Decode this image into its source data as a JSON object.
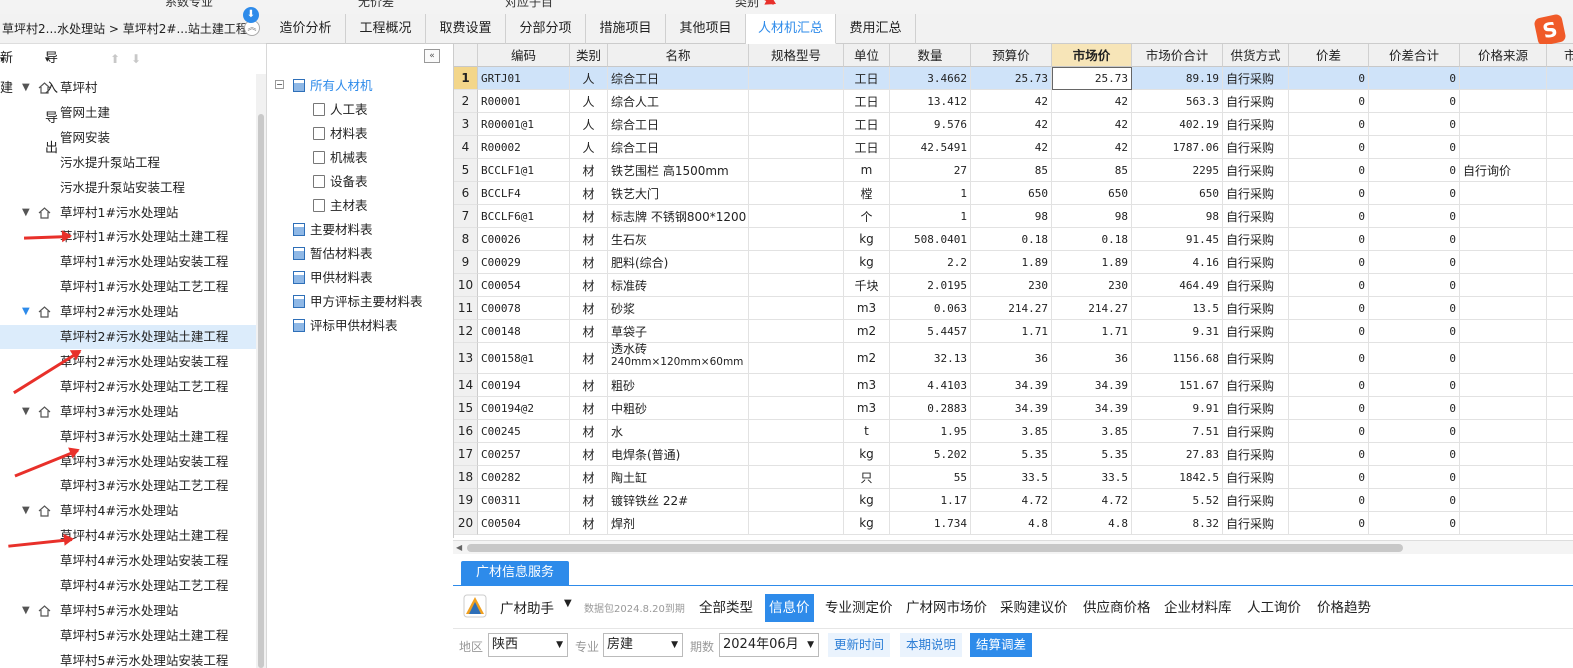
{
  "top_strip": {
    "items": [
      "系数专业",
      "无价差",
      "对应子目",
      "类别"
    ]
  },
  "breadcrumb": {
    "text": "草坪村2...水处理站 > 草坪村2#...站土建工程"
  },
  "tabs": [
    {
      "label": "造价分析"
    },
    {
      "label": "工程概况"
    },
    {
      "label": "取费设置"
    },
    {
      "label": "分部分项"
    },
    {
      "label": "措施项目"
    },
    {
      "label": "其他项目"
    },
    {
      "label": "人材机汇总"
    },
    {
      "label": "费用汇总"
    }
  ],
  "active_tab": "人材机汇总",
  "left_toolbar": {
    "new_label": "新建",
    "import_export_label": "导入导出"
  },
  "tree": {
    "items": [
      {
        "label": "草坪村",
        "level": 0
      },
      {
        "label": "管网土建",
        "level": 1
      },
      {
        "label": "管网安装",
        "level": 1
      },
      {
        "label": "污水提升泵站工程",
        "level": 1
      },
      {
        "label": "污水提升泵站安装工程",
        "level": 1
      },
      {
        "label": "草坪村1#污水处理站",
        "level": 0
      },
      {
        "label": "草坪村1#污水处理站土建工程",
        "level": 1
      },
      {
        "label": "草坪村1#污水处理站安装工程",
        "level": 1
      },
      {
        "label": "草坪村1#污水处理站工艺工程",
        "level": 1
      },
      {
        "label": "草坪村2#污水处理站",
        "level": 0
      },
      {
        "label": "草坪村2#污水处理站土建工程",
        "level": 1,
        "selected": true
      },
      {
        "label": "草坪村2#污水处理站安装工程",
        "level": 1
      },
      {
        "label": "草坪村2#污水处理站工艺工程",
        "level": 1
      },
      {
        "label": "草坪村3#污水处理站",
        "level": 0
      },
      {
        "label": "草坪村3#污水处理站土建工程",
        "level": 1
      },
      {
        "label": "草坪村3#污水处理站安装工程",
        "level": 1
      },
      {
        "label": "草坪村3#污水处理站工艺工程",
        "level": 1
      },
      {
        "label": "草坪村4#污水处理站",
        "level": 0
      },
      {
        "label": "草坪村4#污水处理站土建工程",
        "level": 1
      },
      {
        "label": "草坪村4#污水处理站安装工程",
        "level": 1
      },
      {
        "label": "草坪村4#污水处理站工艺工程",
        "level": 1
      },
      {
        "label": "草坪村5#污水处理站",
        "level": 0
      },
      {
        "label": "草坪村5#污水处理站土建工程",
        "level": 1
      },
      {
        "label": "草坪村5#污水处理站安装工程",
        "level": 1
      }
    ]
  },
  "categories": {
    "root": "所有人材机",
    "children": [
      "人工表",
      "材料表",
      "机械表",
      "设备表",
      "主材表"
    ],
    "tables": [
      "主要材料表",
      "暂估材料表",
      "甲供材料表",
      "甲方评标主要材料表",
      "评标甲供材料表"
    ]
  },
  "grid": {
    "columns": [
      "",
      "编码",
      "类别",
      "名称",
      "规格型号",
      "单位",
      "数量",
      "预算价",
      "市场价",
      "市场价合计",
      "供货方式",
      "价差",
      "价差合计",
      "价格来源",
      "市场"
    ],
    "rows": [
      {
        "n": "1",
        "code": "GRTJ01",
        "type": "人",
        "name": "综合工日",
        "spec": "",
        "unit": "工日",
        "qty": "3.4662",
        "budget": "25.73",
        "market": "25.73",
        "total": "89.19",
        "supply": "自行采购",
        "diff": "0",
        "diff_total": "0",
        "source": ""
      },
      {
        "n": "2",
        "code": "R00001",
        "type": "人",
        "name": "综合人工",
        "spec": "",
        "unit": "工日",
        "qty": "13.412",
        "budget": "42",
        "market": "42",
        "total": "563.3",
        "supply": "自行采购",
        "diff": "0",
        "diff_total": "0",
        "source": ""
      },
      {
        "n": "3",
        "code": "R00001@1",
        "type": "人",
        "name": "综合工日",
        "spec": "",
        "unit": "工日",
        "qty": "9.576",
        "budget": "42",
        "market": "42",
        "total": "402.19",
        "supply": "自行采购",
        "diff": "0",
        "diff_total": "0",
        "source": ""
      },
      {
        "n": "4",
        "code": "R00002",
        "type": "人",
        "name": "综合工日",
        "spec": "",
        "unit": "工日",
        "qty": "42.5491",
        "budget": "42",
        "market": "42",
        "total": "1787.06",
        "supply": "自行采购",
        "diff": "0",
        "diff_total": "0",
        "source": ""
      },
      {
        "n": "5",
        "code": "BCCLF1@1",
        "type": "材",
        "name": "铁艺围栏 高1500mm",
        "spec": "",
        "unit": "m",
        "qty": "27",
        "budget": "85",
        "market": "85",
        "total": "2295",
        "supply": "自行采购",
        "diff": "0",
        "diff_total": "0",
        "source": "自行询价"
      },
      {
        "n": "6",
        "code": "BCCLF4",
        "type": "材",
        "name": "铁艺大门",
        "spec": "",
        "unit": "樘",
        "qty": "1",
        "budget": "650",
        "market": "650",
        "total": "650",
        "supply": "自行采购",
        "diff": "0",
        "diff_total": "0",
        "source": ""
      },
      {
        "n": "7",
        "code": "BCCLF6@1",
        "type": "材",
        "name": "标志牌 不锈钢800*1200",
        "spec": "",
        "unit": "个",
        "qty": "1",
        "budget": "98",
        "market": "98",
        "total": "98",
        "supply": "自行采购",
        "diff": "0",
        "diff_total": "0",
        "source": ""
      },
      {
        "n": "8",
        "code": "C00026",
        "type": "材",
        "name": "生石灰",
        "spec": "",
        "unit": "kg",
        "qty": "508.0401",
        "budget": "0.18",
        "market": "0.18",
        "total": "91.45",
        "supply": "自行采购",
        "diff": "0",
        "diff_total": "0",
        "source": ""
      },
      {
        "n": "9",
        "code": "C00029",
        "type": "材",
        "name": "肥料(综合)",
        "spec": "",
        "unit": "kg",
        "qty": "2.2",
        "budget": "1.89",
        "market": "1.89",
        "total": "4.16",
        "supply": "自行采购",
        "diff": "0",
        "diff_total": "0",
        "source": ""
      },
      {
        "n": "10",
        "code": "C00054",
        "type": "材",
        "name": "标准砖",
        "spec": "",
        "unit": "千块",
        "qty": "2.0195",
        "budget": "230",
        "market": "230",
        "total": "464.49",
        "supply": "自行采购",
        "diff": "0",
        "diff_total": "0",
        "source": ""
      },
      {
        "n": "11",
        "code": "C00078",
        "type": "材",
        "name": "砂浆",
        "spec": "",
        "unit": "m3",
        "qty": "0.063",
        "budget": "214.27",
        "market": "214.27",
        "total": "13.5",
        "supply": "自行采购",
        "diff": "0",
        "diff_total": "0",
        "source": ""
      },
      {
        "n": "12",
        "code": "C00148",
        "type": "材",
        "name": "草袋子",
        "spec": "",
        "unit": "m2",
        "qty": "5.4457",
        "budget": "1.71",
        "market": "1.71",
        "total": "9.31",
        "supply": "自行采购",
        "diff": "0",
        "diff_total": "0",
        "source": ""
      },
      {
        "n": "13",
        "code": "C00158@1",
        "type": "材",
        "name": "透水砖",
        "name2": "240mm×120mm×60mm",
        "spec": "",
        "unit": "m2",
        "qty": "32.13",
        "budget": "36",
        "market": "36",
        "total": "1156.68",
        "supply": "自行采购",
        "diff": "0",
        "diff_total": "0",
        "source": ""
      },
      {
        "n": "14",
        "code": "C00194",
        "type": "材",
        "name": "粗砂",
        "spec": "",
        "unit": "m3",
        "qty": "4.4103",
        "budget": "34.39",
        "market": "34.39",
        "total": "151.67",
        "supply": "自行采购",
        "diff": "0",
        "diff_total": "0",
        "source": ""
      },
      {
        "n": "15",
        "code": "C00194@2",
        "type": "材",
        "name": "中粗砂",
        "spec": "",
        "unit": "m3",
        "qty": "0.2883",
        "budget": "34.39",
        "market": "34.39",
        "total": "9.91",
        "supply": "自行采购",
        "diff": "0",
        "diff_total": "0",
        "source": ""
      },
      {
        "n": "16",
        "code": "C00245",
        "type": "材",
        "name": "水",
        "spec": "",
        "unit": "t",
        "qty": "1.95",
        "budget": "3.85",
        "market": "3.85",
        "total": "7.51",
        "supply": "自行采购",
        "diff": "0",
        "diff_total": "0",
        "source": ""
      },
      {
        "n": "17",
        "code": "C00257",
        "type": "材",
        "name": "电焊条(普通)",
        "spec": "",
        "unit": "kg",
        "qty": "5.202",
        "budget": "5.35",
        "market": "5.35",
        "total": "27.83",
        "supply": "自行采购",
        "diff": "0",
        "diff_total": "0",
        "source": ""
      },
      {
        "n": "18",
        "code": "C00282",
        "type": "材",
        "name": "陶土缸",
        "spec": "",
        "unit": "只",
        "qty": "55",
        "budget": "33.5",
        "market": "33.5",
        "total": "1842.5",
        "supply": "自行采购",
        "diff": "0",
        "diff_total": "0",
        "source": ""
      },
      {
        "n": "19",
        "code": "C00311",
        "type": "材",
        "name": "镀锌铁丝 22#",
        "spec": "",
        "unit": "kg",
        "qty": "1.17",
        "budget": "4.72",
        "market": "4.72",
        "total": "5.52",
        "supply": "自行采购",
        "diff": "0",
        "diff_total": "0",
        "source": ""
      },
      {
        "n": "20",
        "code": "C00504",
        "type": "材",
        "name": "焊剂",
        "spec": "",
        "unit": "kg",
        "qty": "1.734",
        "budget": "4.8",
        "market": "4.8",
        "total": "8.32",
        "supply": "自行采购",
        "diff": "0",
        "diff_total": "0",
        "source": ""
      }
    ]
  },
  "bottom": {
    "service_tab": "广材信息服务",
    "assistant_label": "广材助手",
    "package_note": "数据包2024.8.20到期",
    "tabs": [
      "全部类型",
      "信息价",
      "专业测定价",
      "广材网市场价",
      "采购建议价",
      "供应商价格",
      "企业材料库",
      "人工询价",
      "价格趋势"
    ],
    "active_tab": "信息价",
    "filters": {
      "region_label": "地区",
      "region_value": "陕西",
      "major_label": "专业",
      "major_value": "房建",
      "period_label": "期数",
      "period_value": "2024年06月"
    },
    "buttons": [
      "更新时间",
      "本期说明",
      "结算调差"
    ]
  },
  "colors": {
    "accent": "#2e8bea",
    "annotation_red": "#e8302a",
    "selected_row": "#cfe3f9",
    "header_highlight": "#f7e5b8"
  }
}
